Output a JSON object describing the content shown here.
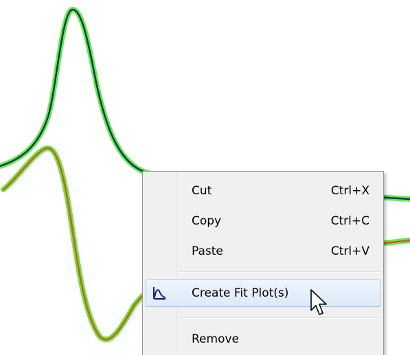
{
  "context_menu": {
    "items": [
      {
        "label": "Cut",
        "shortcut": "Ctrl+X"
      },
      {
        "label": "Copy",
        "shortcut": "Ctrl+C"
      },
      {
        "label": "Paste",
        "shortcut": "Ctrl+V"
      },
      {
        "label": "Create Fit Plot(s)",
        "shortcut": "",
        "icon": "fit-plot-icon",
        "highlighted": true
      },
      {
        "label": "Remove",
        "shortcut": ""
      }
    ]
  },
  "plot": {
    "series_colors": {
      "upper_curve_core": "#0a3a5a",
      "lower_curve_core": "#e0521c",
      "glow": "#66e84a"
    }
  },
  "cursor": {
    "icon": "arrow-cursor-icon"
  }
}
